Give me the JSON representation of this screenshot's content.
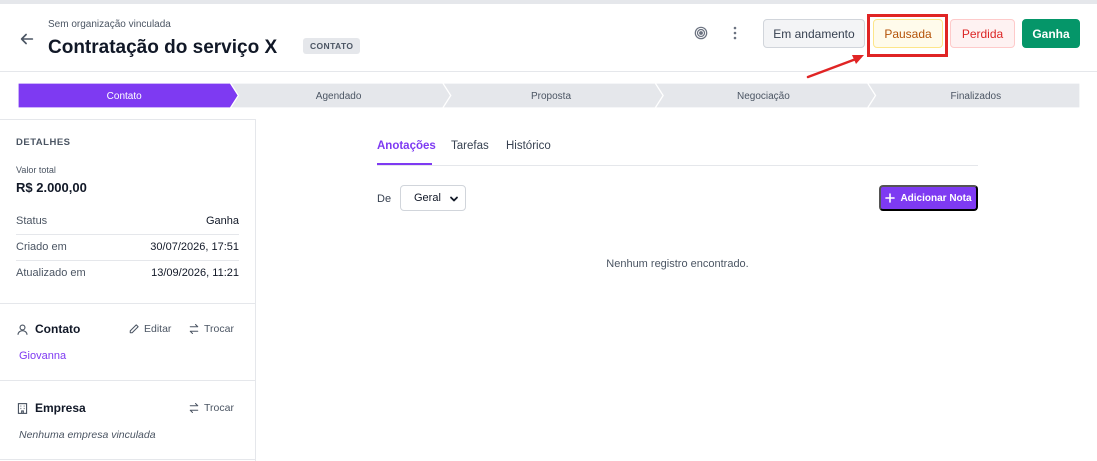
{
  "header": {
    "org_label": "Sem organização vinculada",
    "title": "Contratação do serviço X",
    "stage_badge": "CONTATO"
  },
  "status_buttons": {
    "andamento": "Em andamento",
    "pausada": "Pausada",
    "perdida": "Perdida",
    "ganha": "Ganha"
  },
  "pipeline": {
    "stages": [
      "Contato",
      "Agendado",
      "Proposta",
      "Negociação",
      "Finalizados"
    ],
    "active_index": 0,
    "active_color": "#7e3af2",
    "inactive_color": "#e5e7eb"
  },
  "sidebar": {
    "details_title": "DETALHES",
    "valor_label": "Valor total",
    "valor_value": "R$ 2.000,00",
    "rows": [
      {
        "label": "Status",
        "value": "Ganha"
      },
      {
        "label": "Criado em",
        "value": "30/07/2026, 17:51"
      },
      {
        "label": "Atualizado em",
        "value": "13/09/2026, 11:21"
      }
    ],
    "contact_title": "Contato",
    "edit_label": "Editar",
    "swap_label": "Trocar",
    "contact_name": "Giovanna",
    "company_title": "Empresa",
    "company_swap_label": "Trocar",
    "no_company": "Nenhuma empresa vinculada"
  },
  "main": {
    "tabs": [
      "Anotações",
      "Tarefas",
      "Histórico"
    ],
    "filter_label": "De",
    "filter_value": "Geral",
    "add_note_label": "Adicionar Nota",
    "empty_message": "Nenhum registro encontrado."
  },
  "colors": {
    "accent": "#7e3af2",
    "success": "#059669",
    "danger": "#dc2626",
    "warning": "#b45309",
    "annotation_red": "#e02424"
  }
}
